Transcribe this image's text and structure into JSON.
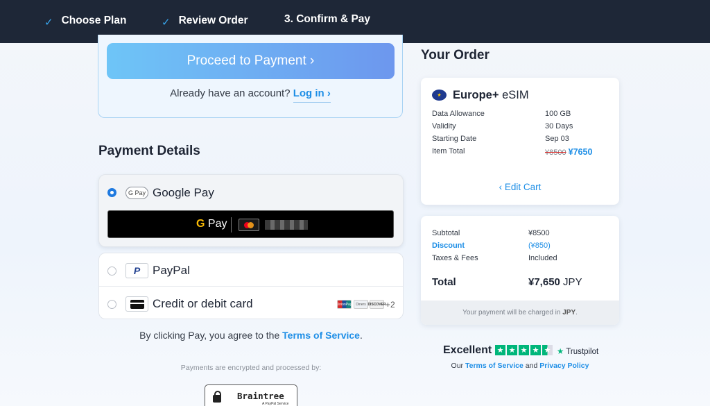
{
  "steps": [
    {
      "label": "Choose Plan",
      "done": true
    },
    {
      "label": "Review Order",
      "done": true
    },
    {
      "label": "3. Confirm & Pay",
      "done": false
    }
  ],
  "account": {
    "proceed_label": "Proceed to Payment ›",
    "already_text": "Already have an account?",
    "login_label": "Log in ›"
  },
  "payment": {
    "title": "Payment Details",
    "google_pay_badge": "G Pay",
    "google_pay_label": "Google Pay",
    "gpay_button_text": "Pay",
    "gpay_button_g": "G",
    "paypal_label": "PayPal",
    "card_label": "Credit or debit card",
    "card_brands": [
      "UnionPay",
      "Diners",
      "DISCOVER"
    ],
    "more_brands": "+2",
    "selected": "google_pay",
    "agree_text": "By clicking Pay, you agree to the",
    "tos_label": "Terms of Service",
    "agree_end": ".",
    "encrypted_text": "Payments are encrypted and processed by:",
    "processor_name": "Braintree",
    "processor_sub": "A PayPal Service"
  },
  "order": {
    "title": "Your Order",
    "product_bold": "Europe+",
    "product_rest": " eSIM",
    "rows": [
      {
        "key": "Data Allowance",
        "value": "100 GB"
      },
      {
        "key": "Validity",
        "value": "30 Days"
      },
      {
        "key": "Starting Date",
        "value": "Sep 03"
      }
    ],
    "item_total_key": "Item Total",
    "item_total_old": "¥8500",
    "item_total_new": "¥7650",
    "edit_cart_label": "‹ Edit Cart"
  },
  "summary": {
    "subtotal_key": "Subtotal",
    "subtotal_val": "¥8500",
    "discount_key": "Discount",
    "discount_val": "(¥850)",
    "taxes_key": "Taxes & Fees",
    "taxes_val": "Included",
    "total_key": "Total",
    "total_amount": "¥7,650",
    "total_currency": " JPY",
    "charged_text": "Your payment will be charged in",
    "charged_currency": "JPY",
    "charged_end": "."
  },
  "trust": {
    "rating_word": "Excellent",
    "stars": 4.5,
    "brand": "Trustpilot",
    "our_text": "Our",
    "tos_label": "Terms of Service",
    "and_text": "and",
    "privacy_label": "Privacy Policy"
  },
  "colors": {
    "topbar": "#1e2737",
    "accent": "#1d8ee6",
    "trustpilot_green": "#00b67a"
  }
}
